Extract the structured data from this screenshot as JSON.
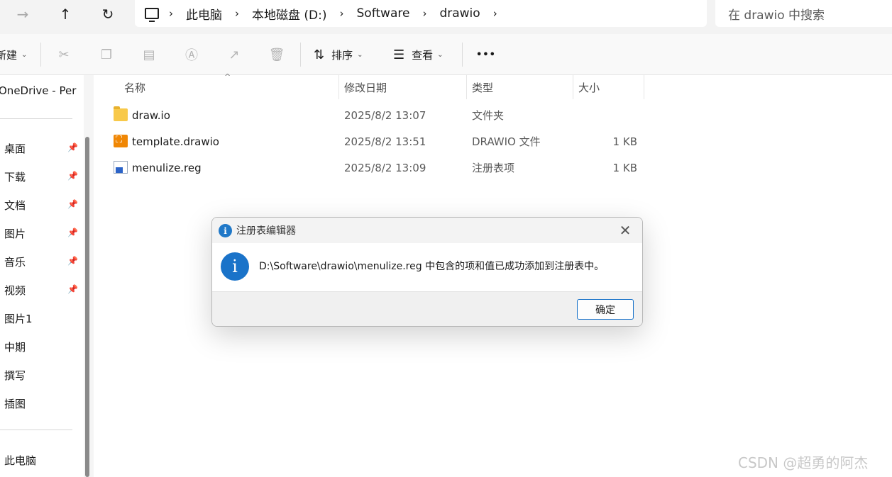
{
  "nav": {
    "back_icon": "arrow-right",
    "up_icon": "arrow-up",
    "refresh_icon": "refresh"
  },
  "address": {
    "crumbs": [
      "此电脑",
      "本地磁盘 (D:)",
      "Software",
      "drawio"
    ],
    "search_placeholder": "在 drawio 中搜索"
  },
  "commandbar": {
    "new_label": "新建",
    "sort_label": "排序",
    "view_label": "查看",
    "more_label": "•••"
  },
  "sidebar": {
    "onedrive": "OneDrive - Per",
    "items": [
      "桌面",
      "下载",
      "文档",
      "图片",
      "音乐",
      "视频",
      "图片1",
      "中期",
      "撰写",
      "插图"
    ],
    "this_pc": "此电脑"
  },
  "filelist": {
    "columns": [
      "名称",
      "修改日期",
      "类型",
      "大小"
    ],
    "rows": [
      {
        "name": "draw.io",
        "date": "2025/8/2 13:07",
        "type": "文件夹",
        "size": ""
      },
      {
        "name": "template.drawio",
        "date": "2025/8/2 13:51",
        "type": "DRAWIO 文件",
        "size": "1 KB"
      },
      {
        "name": "menulize.reg",
        "date": "2025/8/2 13:09",
        "type": "注册表项",
        "size": "1 KB"
      }
    ]
  },
  "dialog": {
    "title": "注册表编辑器",
    "message": "D:\\Software\\drawio\\menulize.reg 中包含的项和值已成功添加到注册表中。",
    "ok_label": "确定",
    "info_glyph": "i"
  },
  "watermark": "CSDN @超勇的阿杰",
  "colors": {
    "accent": "#1a73c9",
    "folder": "#f8c94a",
    "drawio": "#f08705"
  }
}
